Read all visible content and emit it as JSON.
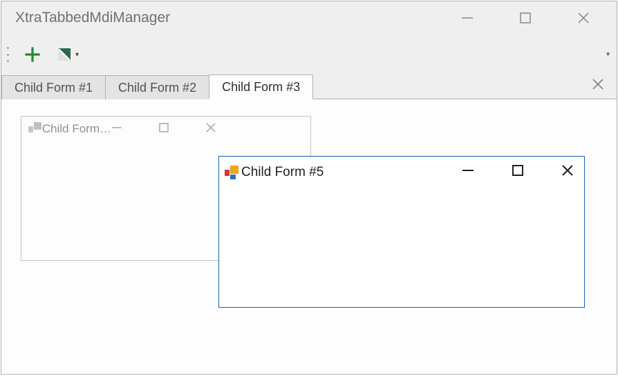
{
  "window": {
    "title": "XtraTabbedMdiManager"
  },
  "tabs": [
    {
      "label": "Child Form #1",
      "active": false
    },
    {
      "label": "Child Form #2",
      "active": false
    },
    {
      "label": "Child Form #3",
      "active": true
    }
  ],
  "childWindows": {
    "back": {
      "title": "Child Form…"
    },
    "front": {
      "title": "Child Form #5"
    }
  },
  "icons": {
    "add": "add-icon",
    "skin": "skin-chooser-icon"
  }
}
